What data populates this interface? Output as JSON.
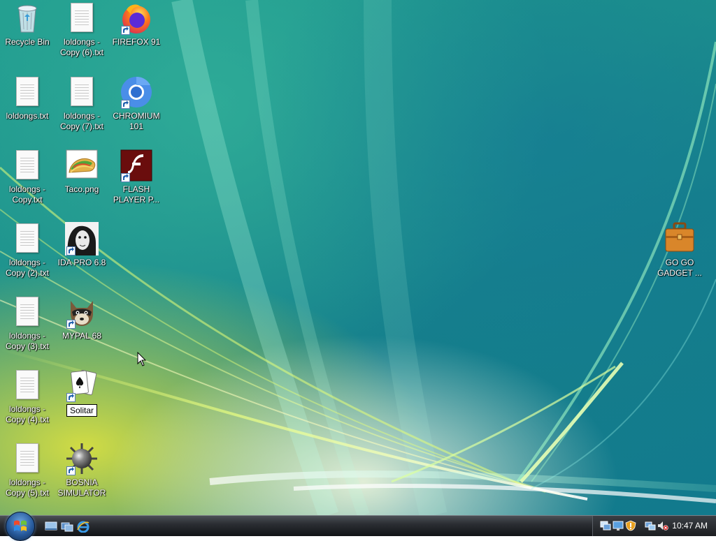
{
  "desktop": {
    "icons": [
      {
        "label": "Recycle Bin",
        "icon": "recycle-bin-icon"
      },
      {
        "label": "loldongs - Copy (6).txt",
        "icon": "text-file-icon"
      },
      {
        "label": "FIREFOX 91",
        "icon": "firefox-icon",
        "shortcut": true
      },
      {
        "label": "loldongs.txt",
        "icon": "text-file-icon"
      },
      {
        "label": "loldongs - Copy (7).txt",
        "icon": "text-file-icon"
      },
      {
        "label": "CHROMIUM 101",
        "icon": "chromium-icon",
        "shortcut": true
      },
      {
        "label": "loldongs - Copy.txt",
        "icon": "text-file-icon"
      },
      {
        "label": "Taco.png",
        "icon": "image-file-icon"
      },
      {
        "label": "FLASH PLAYER P...",
        "icon": "flash-player-icon",
        "shortcut": true
      },
      {
        "label": "loldongs - Copy (2).txt",
        "icon": "text-file-icon"
      },
      {
        "label": "IDA PRO 6.8",
        "icon": "ida-pro-icon",
        "shortcut": true
      },
      {
        "label": "loldongs - Copy (3).txt",
        "icon": "text-file-icon"
      },
      {
        "label": "MYPAL 68",
        "icon": "mypal-raccoon-icon",
        "shortcut": true
      },
      {
        "label": "loldongs - Copy (4).txt",
        "icon": "text-file-icon"
      },
      {
        "label": "Solitar",
        "icon": "solitaire-cards-icon",
        "shortcut": true,
        "renaming": true
      },
      {
        "label": "loldongs - Copy (5).txt",
        "icon": "text-file-icon"
      },
      {
        "label": "BOSNIA SIMULATOR",
        "icon": "minesweeper-mine-icon",
        "shortcut": true
      },
      {
        "label": "GO GO GADGET ...",
        "icon": "briefcase-icon",
        "shortcut": false
      }
    ]
  },
  "taskbar": {
    "start_icon": "windows-start-orb-icon",
    "quick_launch": [
      "show-desktop-icon",
      "switch-windows-icon",
      "internet-explorer-icon"
    ],
    "tray_icons": [
      "network-drive-icon",
      "display-settings-icon",
      "security-alert-icon",
      "network-status-icon",
      "volume-muted-icon"
    ],
    "clock": "10:47 AM"
  },
  "colors": {
    "taskbar_dark": "#111316",
    "wallpaper_teal": "#1c8f8c",
    "wallpaper_yellow": "#d8e03a"
  }
}
